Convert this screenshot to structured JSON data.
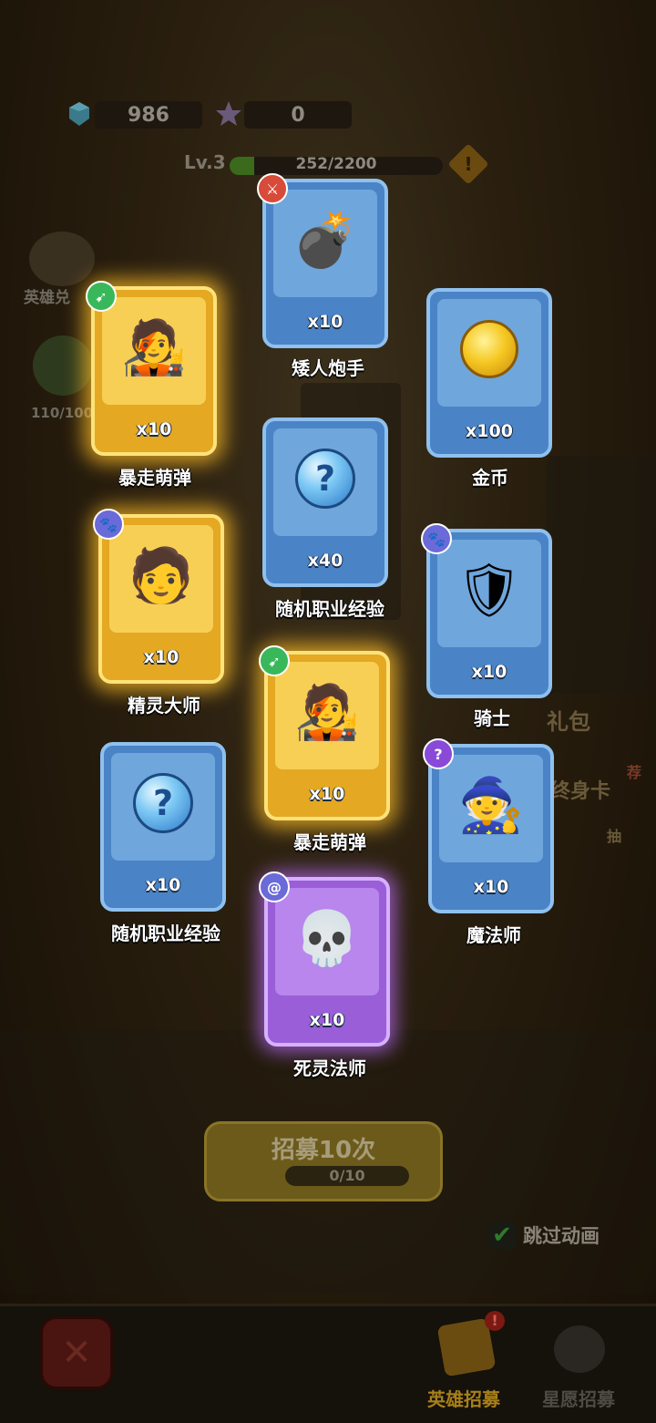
{
  "hud": {
    "gems": "986",
    "stars": "0",
    "level": "Lv.3",
    "xp_text": "252/2200",
    "xp_progress": 0.1145,
    "warn_glyph": "!"
  },
  "side": {
    "hero_exchange": "英雄兑",
    "count": "110/100"
  },
  "cards": [
    {
      "name": "矮人炮手",
      "qty": "x10",
      "badge_glyph": "⚔",
      "badge_icon": "sword-class-icon",
      "art": "💣",
      "art_icon": "dwarf-gunner-portrait"
    },
    {
      "name": "暴走萌弹",
      "qty": "x10",
      "badge_glyph": "➹",
      "badge_icon": "archer-class-icon",
      "art": "🧑‍🎤",
      "art_icon": "hero-cannon-girl-portrait"
    },
    {
      "name": "金币",
      "qty": "x100",
      "art_icon": "gold-coin-icon"
    },
    {
      "name": "随机职业经验",
      "qty": "x40",
      "art_glyph": "?",
      "art_icon": "question-orb-icon"
    },
    {
      "name": "精灵大师",
      "qty": "x10",
      "badge_glyph": "🐾",
      "badge_icon": "beast-class-icon",
      "art": "🧑",
      "art_icon": "spirit-master-portrait"
    },
    {
      "name": "骑士",
      "qty": "x10",
      "badge_glyph": "🐾",
      "badge_icon": "beast-class-icon",
      "art": "🛡",
      "art_icon": "knight-portrait"
    },
    {
      "name": "暴走萌弹",
      "qty": "x10",
      "badge_glyph": "➹",
      "badge_icon": "archer-class-icon",
      "art": "🧑‍🎤",
      "art_icon": "hero-cannon-girl-portrait"
    },
    {
      "name": "随机职业经验",
      "qty": "x10",
      "art_glyph": "?",
      "art_icon": "question-orb-icon"
    },
    {
      "name": "魔法师",
      "qty": "x10",
      "badge_glyph": "?",
      "badge_icon": "mage-class-icon",
      "art": "🧙",
      "art_icon": "mage-portrait"
    },
    {
      "name": "死灵法师",
      "qty": "x10",
      "badge_glyph": "@",
      "badge_icon": "spiral-class-icon",
      "art": "💀",
      "art_icon": "necromancer-portrait"
    }
  ],
  "bg_labels": {
    "gift": "礼包",
    "card": "终身卡",
    "recommend": "荐",
    "draw": "抽"
  },
  "recruit": {
    "button_label": "招募10次",
    "progress": "0/10"
  },
  "skip": {
    "label": "跳过动画",
    "check": "✔"
  },
  "bottom_nav": {
    "close_glyph": "✕",
    "hero_recruit": "英雄招募",
    "hero_badge": "!",
    "star_recruit": "星愿招募"
  },
  "colors": {
    "blue_card": "#4a84c6",
    "gold_card": "#e4a822",
    "purple_card": "#9a5ed8",
    "active_tab": "#a7801a",
    "inactive_tab": "#4e4a44"
  }
}
